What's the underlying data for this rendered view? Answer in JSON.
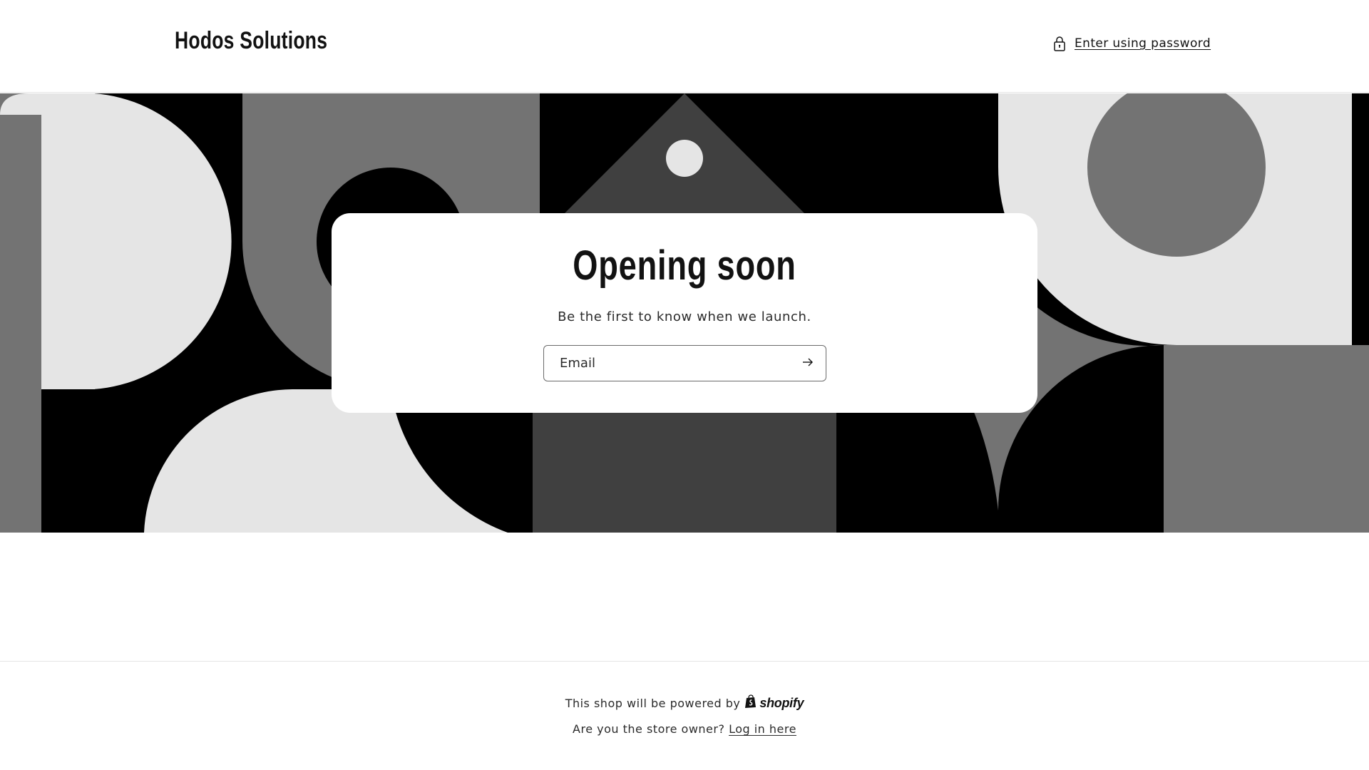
{
  "header": {
    "brand": "Hodos Solutions",
    "password_link": "Enter using password",
    "lock_icon": "lock-icon"
  },
  "banner": {
    "colors": {
      "black": "#000000",
      "dark_gray": "#404040",
      "mid_gray": "#737373",
      "light_gray": "#e5e5e5"
    }
  },
  "card": {
    "title": "Opening soon",
    "subtitle": "Be the first to know when we launch.",
    "email_placeholder": "Email",
    "submit_icon": "arrow-right-icon"
  },
  "footer": {
    "powered_text": "This shop will be powered by",
    "shopify_word": "shopify",
    "shopify_icon": "shopify-bag-icon",
    "owner_text": "Are you the store owner?",
    "login_link": "Log in here"
  }
}
